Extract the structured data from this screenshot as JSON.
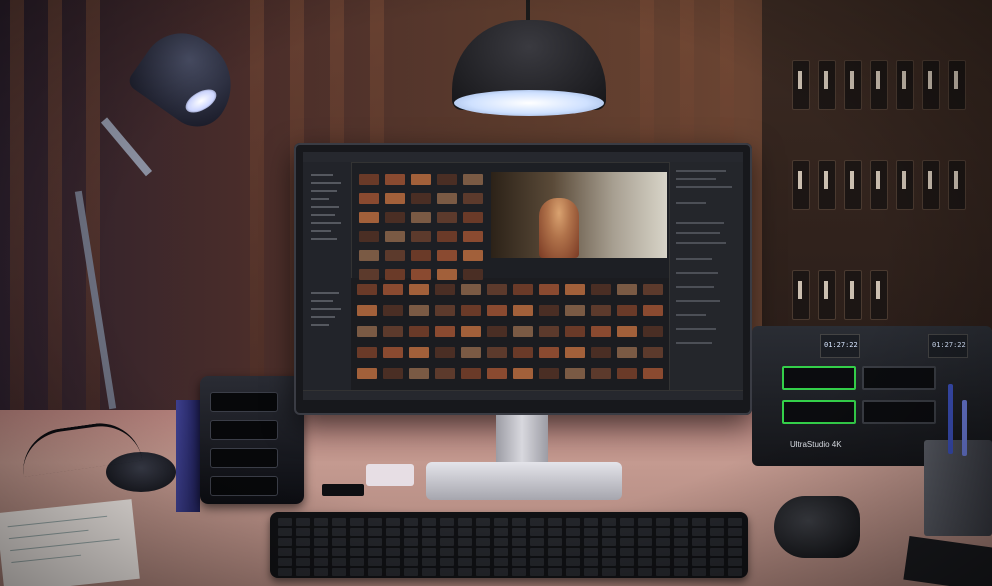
{
  "scene": {
    "colors": {
      "lamp_glow": "#cfe1ff",
      "indicator_green": "#34d04a",
      "wall": "#5a3a2c",
      "desk": "#c49a90"
    }
  },
  "ultrastudio": {
    "label": "UltraStudio 4K",
    "timecode_left": "01:27:22",
    "timecode_right": "01:27:22"
  }
}
